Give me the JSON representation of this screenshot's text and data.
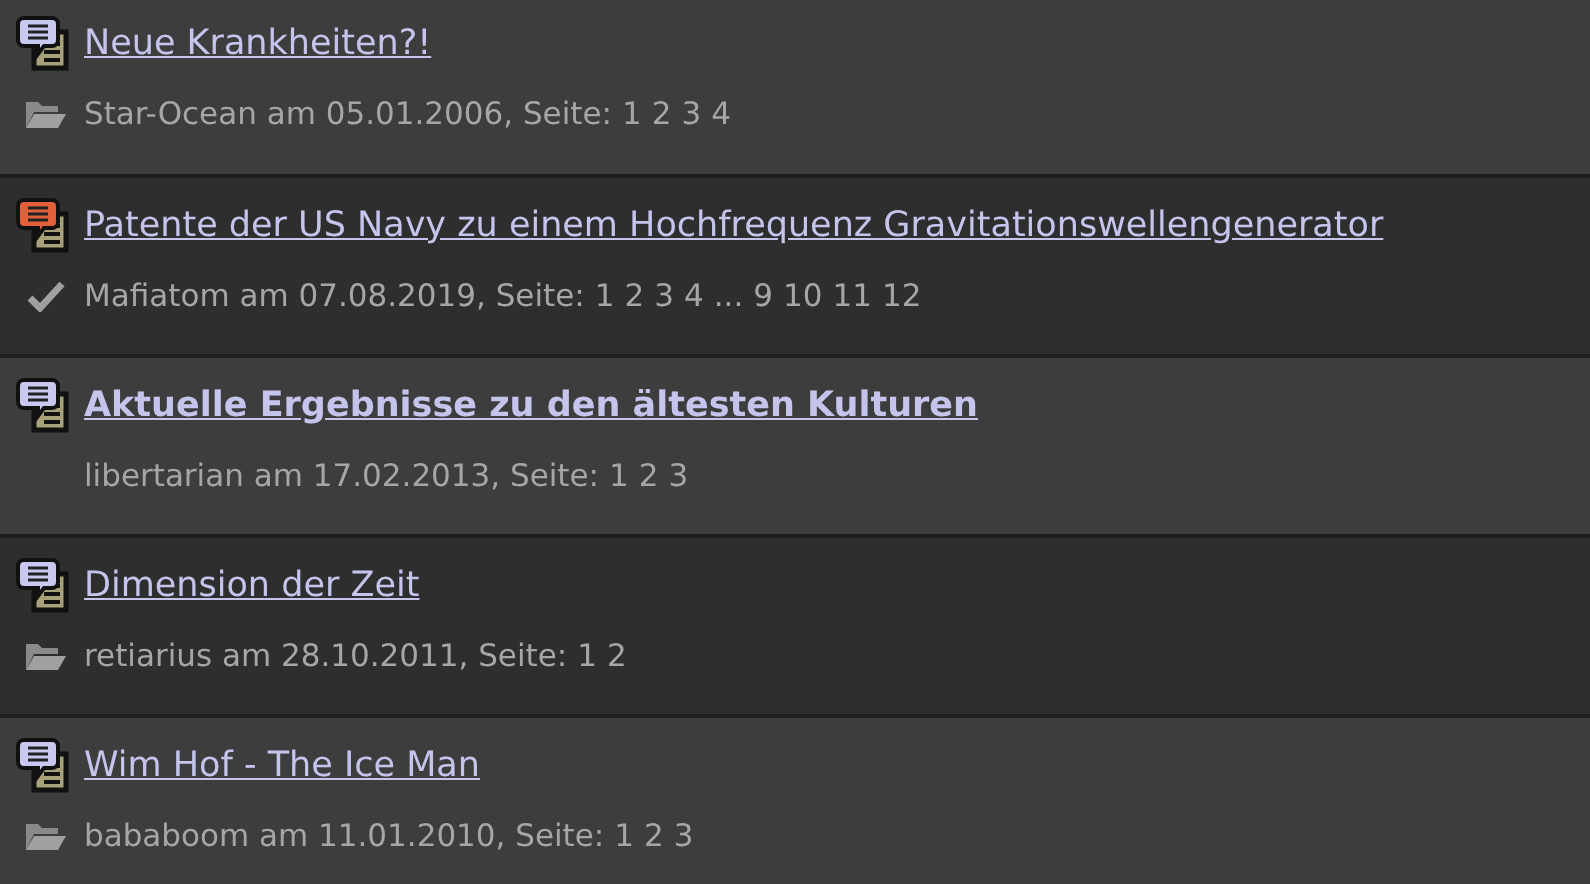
{
  "topics": [
    {
      "title": "Neue Krankheiten?!",
      "bold": false,
      "hot": false,
      "status": {
        "kind": "folder"
      },
      "meta": "Star-Ocean am 05.01.2006, Seite:",
      "pages": [
        "1",
        "2",
        "3",
        "4"
      ]
    },
    {
      "title": "Patente der US Navy zu einem Hochfrequenz Gravitationswellengenerator",
      "bold": false,
      "hot": true,
      "status": {
        "kind": "check"
      },
      "meta": "Mafiatom am 07.08.2019, Seite:",
      "pages": [
        "1",
        "2",
        "3",
        "4",
        "...",
        "9",
        "10",
        "11",
        "12"
      ]
    },
    {
      "title": "Aktuelle Ergebnisse zu den ältesten Kulturen",
      "bold": true,
      "hot": false,
      "meta": "libertarian am 17.02.2013, Seite:",
      "pages": [
        "1",
        "2",
        "3"
      ]
    },
    {
      "title": "Dimension der Zeit",
      "bold": false,
      "hot": false,
      "status": {
        "kind": "folder"
      },
      "meta": "retiarius am 28.10.2011, Seite:",
      "pages": [
        "1",
        "2"
      ]
    },
    {
      "title": "Wim Hof - The Ice Man",
      "bold": false,
      "hot": false,
      "status": {
        "kind": "folder"
      },
      "meta": "bababoom am 11.01.2010, Seite:",
      "pages": [
        "1",
        "2",
        "3"
      ]
    }
  ]
}
